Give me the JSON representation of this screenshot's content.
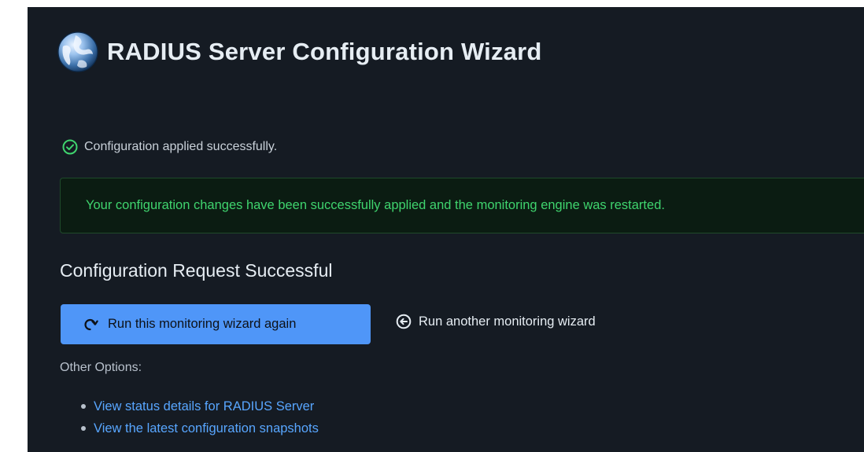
{
  "header": {
    "title": "RADIUS Server Configuration Wizard",
    "icon": "globe-icon"
  },
  "status": {
    "message": "Configuration applied successfully.",
    "icon": "check-circle-icon",
    "color": "#3fd46e"
  },
  "alert": {
    "message": "Your configuration changes have been successfully applied and the monitoring engine was restarted.",
    "text_color": "#3fd46e",
    "background": "#0b1c12"
  },
  "result": {
    "title": "Configuration Request Successful"
  },
  "actions": {
    "run_again_label": "Run this monitoring wizard again",
    "run_again_icon": "redo-icon",
    "run_another_label": "Run another monitoring wizard",
    "run_another_icon": "arrow-left-circle-icon",
    "primary_color": "#4f96f8"
  },
  "other_options": {
    "label": "Other Options:",
    "links": [
      {
        "label": "View status details for RADIUS Server"
      },
      {
        "label": "View the latest configuration snapshots"
      }
    ],
    "link_color": "#58a6ff"
  }
}
